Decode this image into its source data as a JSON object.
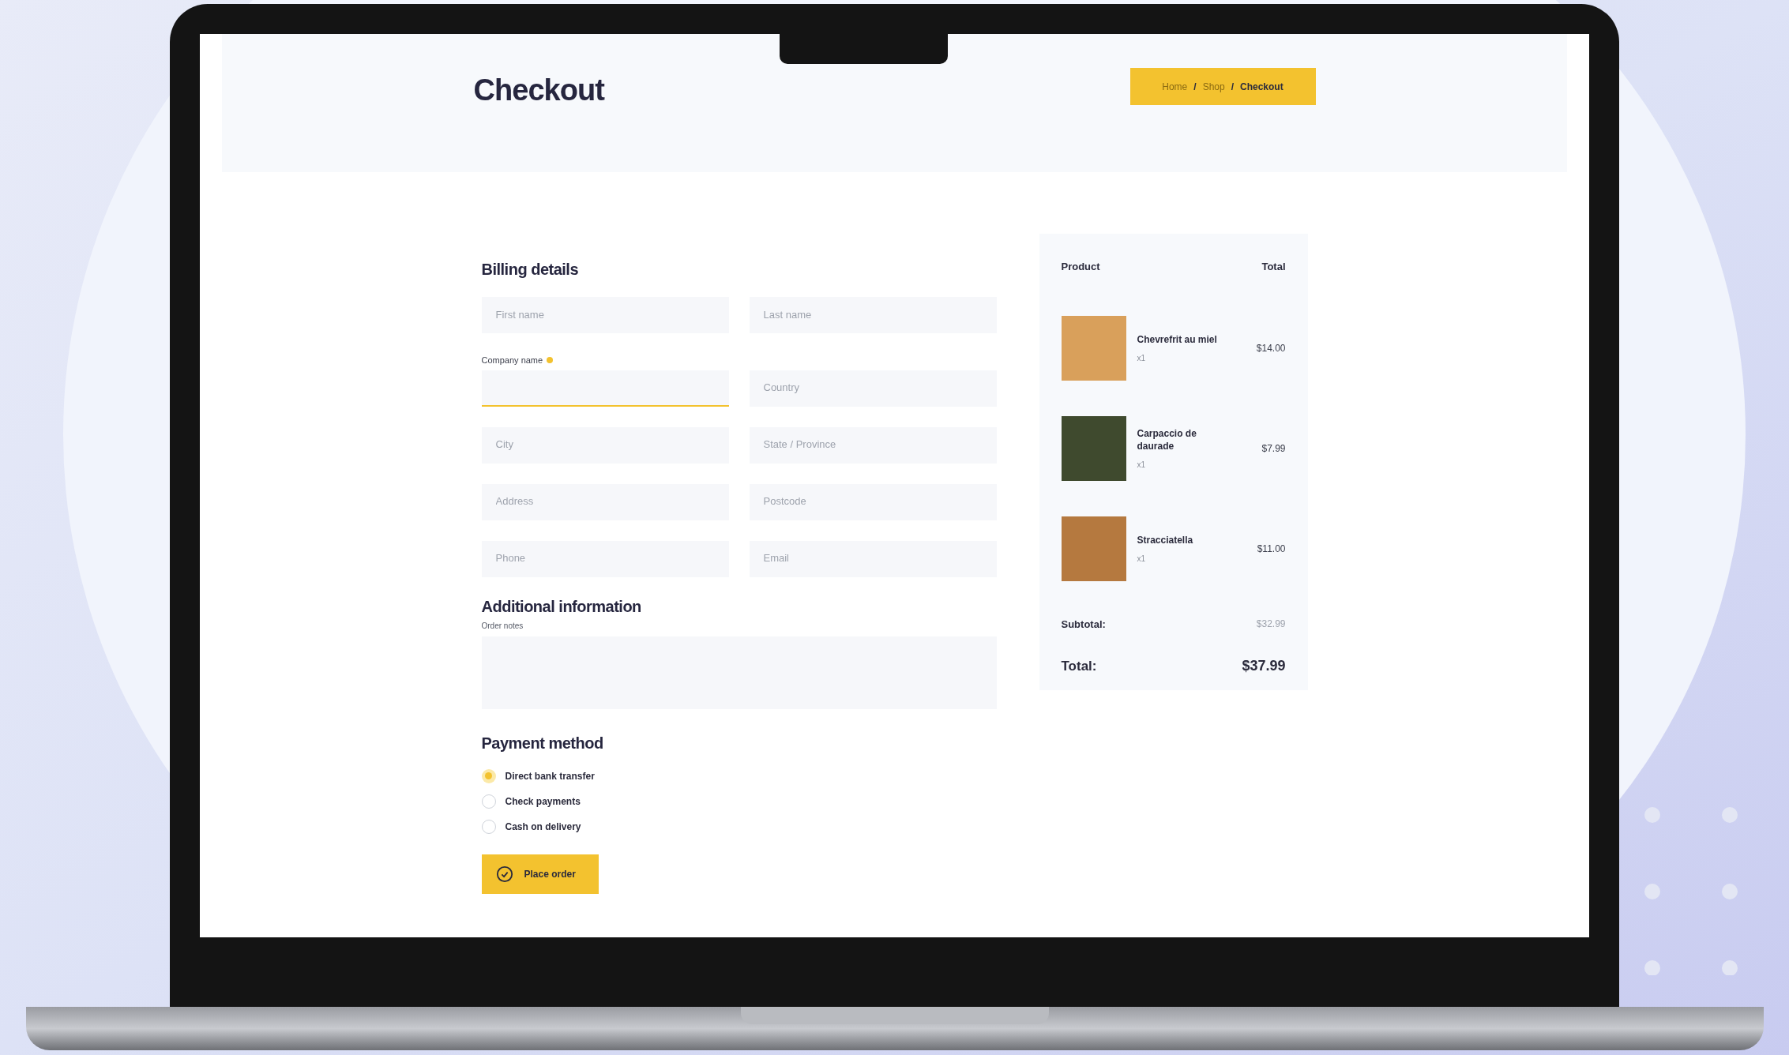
{
  "header": {
    "title": "Checkout",
    "breadcrumb": [
      {
        "kind": "link",
        "label": "Home"
      },
      {
        "kind": "separator",
        "label": "/"
      },
      {
        "kind": "link",
        "label": "Shop"
      },
      {
        "kind": "separator",
        "label": "/"
      },
      {
        "kind": "current",
        "label": "Checkout"
      }
    ]
  },
  "billing": {
    "heading": "Billing details",
    "fields": [
      {
        "placeholder": "First name",
        "focused": false
      },
      {
        "placeholder": "Last name",
        "focused": false
      },
      {
        "label": "Company name",
        "required": true,
        "focused": true
      },
      {
        "placeholder": "Country",
        "focused": false
      },
      {
        "placeholder": "City",
        "focused": false
      },
      {
        "placeholder": "State / Province",
        "focused": false
      },
      {
        "placeholder": "Address",
        "focused": false
      },
      {
        "placeholder": "Postcode",
        "focused": false
      },
      {
        "placeholder": "Phone",
        "focused": false
      },
      {
        "placeholder": "Email",
        "focused": false
      }
    ]
  },
  "additional": {
    "heading": "Additional information",
    "notes_label": "Order notes"
  },
  "payment": {
    "heading": "Payment method",
    "options": [
      {
        "label": "Direct bank transfer",
        "selected": true
      },
      {
        "label": "Check payments",
        "selected": false
      },
      {
        "label": "Cash on delivery",
        "selected": false
      }
    ],
    "button": "Place order"
  },
  "order": {
    "columns": [
      "Product",
      "Total"
    ],
    "items": [
      {
        "name": "Chevrefrit au miel",
        "quantity": "x1",
        "price": "$14.00"
      },
      {
        "name": "Carpaccio de daurade",
        "quantity": "x1",
        "price": "$7.99"
      },
      {
        "name": "Stracciatella",
        "quantity": "x1",
        "price": "$11.00"
      }
    ],
    "subtotal_label": "Subtotal:",
    "subtotal": "$32.99",
    "total_label": "Total:",
    "total": "$37.99"
  }
}
